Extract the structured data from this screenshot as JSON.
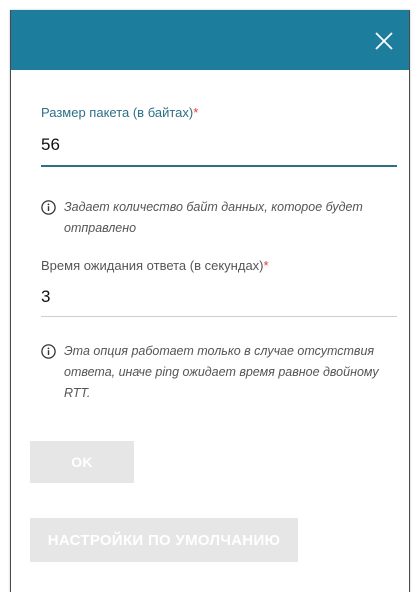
{
  "dialog": {
    "colors": {
      "header": "#1d7d9c",
      "accent": "#2c6f88",
      "required": "#e53935"
    },
    "close_icon": "close-icon"
  },
  "packet_size": {
    "label": "Размер пакета (в байтах)",
    "required_mark": "*",
    "value": "56",
    "hint": "Задает количество байт данных, которое будет отправлено",
    "hint_icon": "info-icon"
  },
  "timeout": {
    "label": "Время ожидания ответа (в секундах)",
    "required_mark": "*",
    "value": "3",
    "hint": "Эта опция работает только в случае отсутствия ответа, иначе ping ожидает время равное двойному RTT.",
    "hint_icon": "info-icon"
  },
  "buttons": {
    "ok": "OK",
    "defaults": "НАСТРОЙКИ ПО УМОЛЧАНИЮ"
  }
}
